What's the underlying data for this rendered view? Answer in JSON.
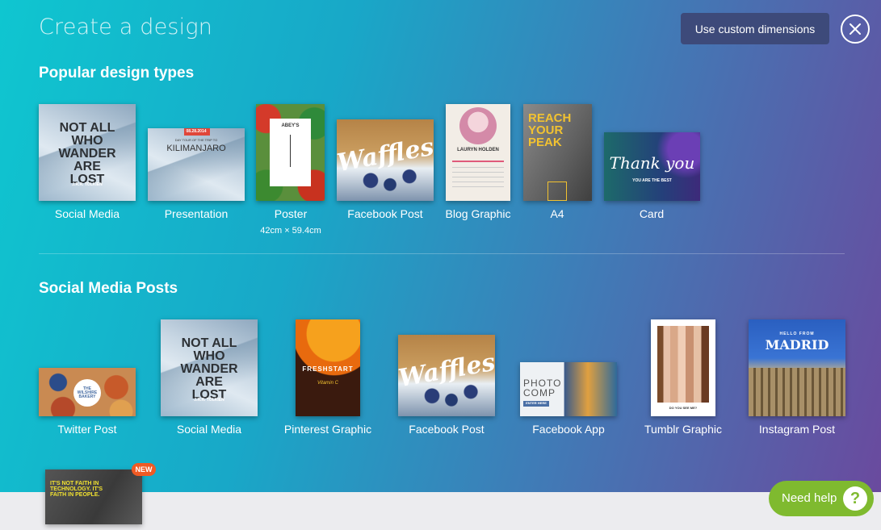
{
  "header": {
    "title": "Create a design",
    "custom_dimensions_label": "Use custom dimensions"
  },
  "sections": {
    "popular": {
      "title": "Popular design types"
    },
    "social": {
      "title": "Social Media Posts"
    }
  },
  "popular_items": [
    {
      "label": "Social Media",
      "art_text": "NOT ALL WHO WANDER ARE LOST",
      "art_sub": "J.R.R. TOLKIEN"
    },
    {
      "label": "Presentation",
      "art_text": "KILIMANJARO",
      "art_date": "08.28.2014",
      "art_sub": "DAY TOUR OF THE TRIP TO"
    },
    {
      "label": "Poster",
      "sub": "42cm × 59.4cm",
      "art_text": "ABEY'S"
    },
    {
      "label": "Facebook Post",
      "art_text": "Waffles"
    },
    {
      "label": "Blog Graphic",
      "art_text": "LAURYN HOLDEN"
    },
    {
      "label": "A4",
      "art_text": "REACH YOUR PEAK"
    },
    {
      "label": "Card",
      "art_text": "Thank you",
      "art_sub": "YOU ARE THE BEST"
    }
  ],
  "social_items": [
    {
      "label": "Twitter Post",
      "art_text": "THE WILSHIRE BAKERY"
    },
    {
      "label": "Social Media",
      "art_text": "NOT ALL WHO WANDER ARE LOST",
      "art_sub": "J.R.R. TOLKIEN"
    },
    {
      "label": "Pinterest Graphic",
      "art_text": "FRESHSTART",
      "art_sub": "Vitamin C"
    },
    {
      "label": "Facebook Post",
      "art_text": "Waffles"
    },
    {
      "label": "Facebook App",
      "art_text": "PHOTO COMP",
      "art_sub": "ENTER HERE"
    },
    {
      "label": "Tumblr Graphic",
      "art_sub": "DO YOU SEE ME?"
    },
    {
      "label": "Instagram Post",
      "art_text": "MADRID",
      "art_sub": "HELLO FROM"
    }
  ],
  "extra_item": {
    "badge": "NEW",
    "art_text": "IT'S NOT FAITH IN TECHNOLOGY. IT'S FAITH IN PEOPLE."
  },
  "help": {
    "label": "Need help",
    "icon_glyph": "?"
  },
  "colors": {
    "gradient_start": "#0fc6d0",
    "gradient_end": "#6a4a9e",
    "button_bg": "#3d4a7a",
    "help_bg": "#7fba2f",
    "badge_bg": "#ef5a24"
  }
}
